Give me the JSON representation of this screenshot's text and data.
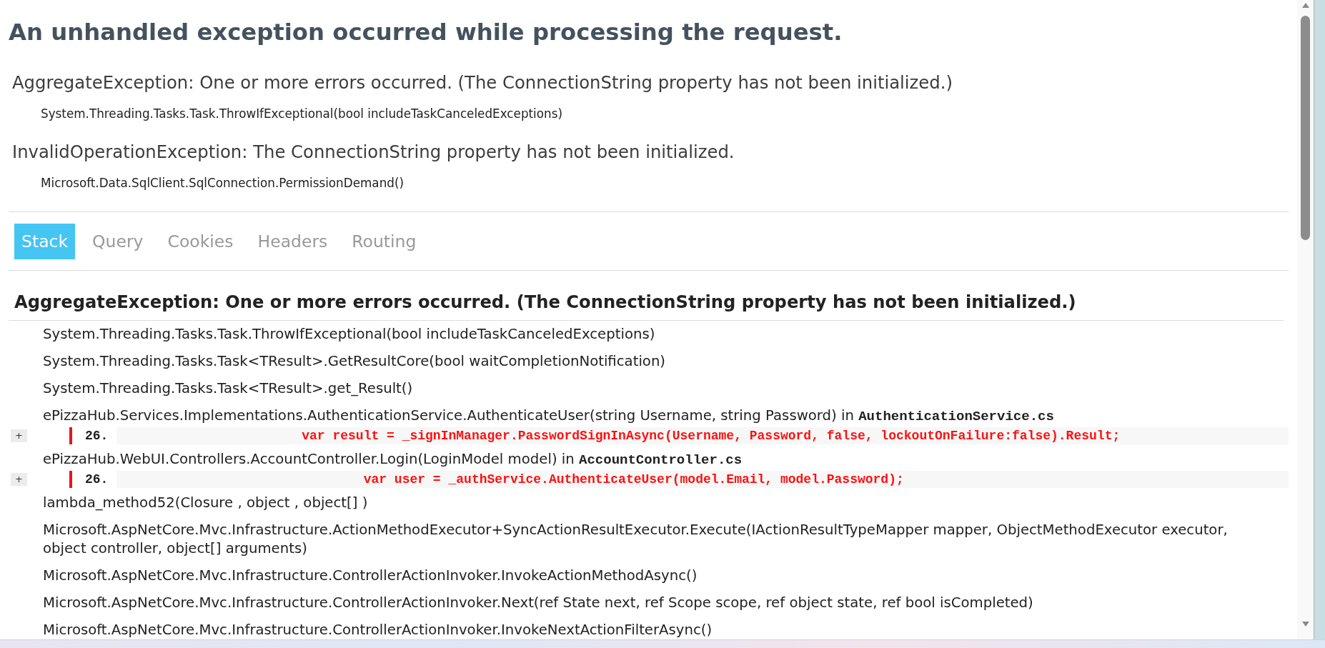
{
  "page": {
    "title": "An unhandled exception occurred while processing the request."
  },
  "summary": [
    {
      "message": "AggregateException: One or more errors occurred. (The ConnectionString property has not been initialized.)",
      "location": "System.Threading.Tasks.Task.ThrowIfExceptional(bool includeTaskCanceledExceptions)"
    },
    {
      "message": "InvalidOperationException: The ConnectionString property has not been initialized.",
      "location": "Microsoft.Data.SqlClient.SqlConnection.PermissionDemand()"
    }
  ],
  "tabs": [
    {
      "label": "Stack",
      "selected": true
    },
    {
      "label": "Query",
      "selected": false
    },
    {
      "label": "Cookies",
      "selected": false
    },
    {
      "label": "Headers",
      "selected": false
    },
    {
      "label": "Routing",
      "selected": false
    }
  ],
  "stack": {
    "heading": "AggregateException: One or more errors occurred. (The ConnectionString property has not been initialized.)",
    "frames": [
      {
        "method": "System.Threading.Tasks.Task.ThrowIfExceptional(bool includeTaskCanceledExceptions)"
      },
      {
        "method": "System.Threading.Tasks.Task<TResult>.GetResultCore(bool waitCompletionNotification)"
      },
      {
        "method": "System.Threading.Tasks.Task<TResult>.get_Result()"
      },
      {
        "method": "ePizzaHub.Services.Implementations.AuthenticationService.AuthenticateUser(string Username, string Password) in **AuthenticationService.cs**",
        "source": {
          "expander": "+",
          "line_number": "26.",
          "code": "                        var result = _signInManager.PasswordSignInAsync(Username, Password, false, lockoutOnFailure:false).Result;"
        }
      },
      {
        "method": "ePizzaHub.WebUI.Controllers.AccountController.Login(LoginModel model) in **AccountController.cs**",
        "source": {
          "expander": "+",
          "line_number": "26.",
          "code": "                                var user = _authService.AuthenticateUser(model.Email, model.Password);"
        }
      },
      {
        "method": "lambda_method52(Closure , object , object[] )"
      },
      {
        "method": "Microsoft.AspNetCore.Mvc.Infrastructure.ActionMethodExecutor+SyncActionResultExecutor.Execute(IActionResultTypeMapper mapper, ObjectMethodExecutor executor, object controller, object[] arguments)"
      },
      {
        "method": "Microsoft.AspNetCore.Mvc.Infrastructure.ControllerActionInvoker.InvokeActionMethodAsync()"
      },
      {
        "method": "Microsoft.AspNetCore.Mvc.Infrastructure.ControllerActionInvoker.Next(ref State next, ref Scope scope, ref object state, ref bool isCompleted)"
      },
      {
        "method": "Microsoft.AspNetCore.Mvc.Infrastructure.ControllerActionInvoker.InvokeNextActionFilterAsync()"
      }
    ]
  }
}
